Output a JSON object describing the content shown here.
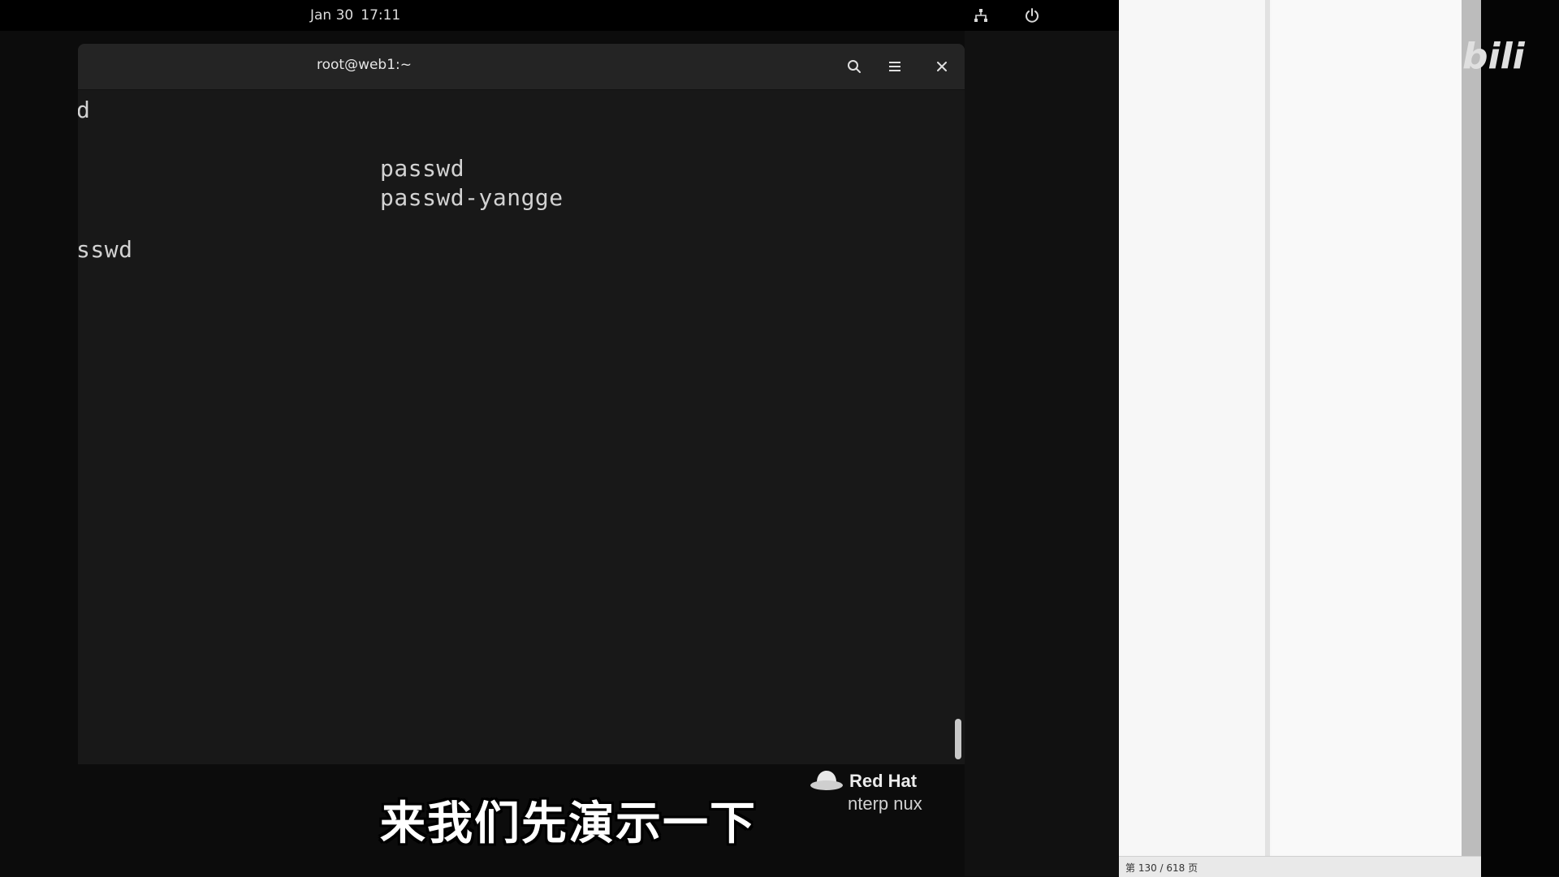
{
  "topbar": {
    "date": "Jan 30",
    "time": "17:11",
    "icons": [
      "network-icon",
      "power-icon"
    ]
  },
  "terminal": {
    "title": "root@web1:~",
    "header_icons": [
      "search-icon",
      "menu-icon",
      "close-icon"
    ],
    "lines": [
      "d",
      "passwd",
      "passwd-yangge",
      "sswd"
    ]
  },
  "branding": {
    "company": "Red Hat",
    "product": "nterp    nux"
  },
  "subtitle": "来我们先演示一下",
  "doc_viewer": {
    "status": "第 130 / 618 页"
  },
  "watermark": "bili"
}
